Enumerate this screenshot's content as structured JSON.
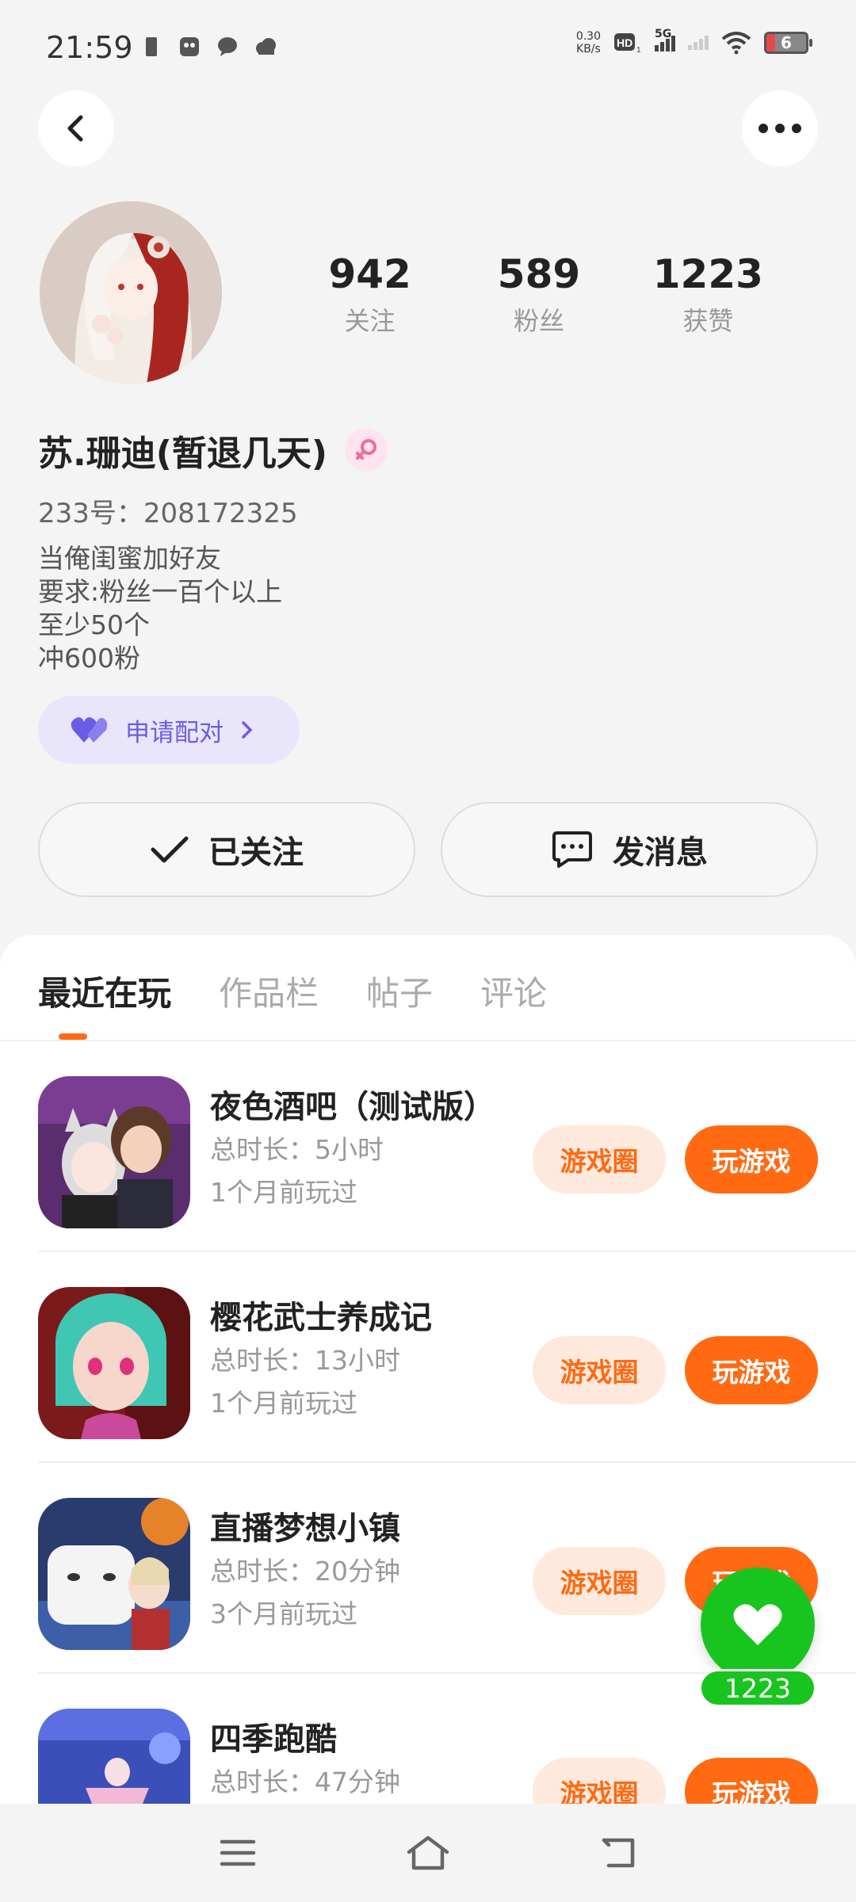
{
  "status_bar": {
    "time": "21:59",
    "net_speed_value": "0.30",
    "net_speed_unit": "KB/s",
    "network": "5G",
    "battery": "6"
  },
  "profile": {
    "username": "苏.珊迪(暂退几天)",
    "uid": "233号：208172325",
    "bio": [
      "当俺闺蜜加好友",
      "要求:粉丝一百个以上",
      "至少50个",
      "冲600粉"
    ],
    "stats": [
      {
        "value": "942",
        "label": "关注"
      },
      {
        "value": "589",
        "label": "粉丝"
      },
      {
        "value": "1223",
        "label": "获赞"
      }
    ],
    "pair_button": "申请配对",
    "follow_button": "已关注",
    "message_button": "发消息"
  },
  "tabs": [
    "最近在玩",
    "作品栏",
    "帖子",
    "评论"
  ],
  "games": [
    {
      "name": "夜色酒吧（测试版）",
      "duration": "总时长：5小时",
      "last_played": "1个月前玩过",
      "circle": "游戏圈",
      "play": "玩游戏"
    },
    {
      "name": "樱花武士养成记",
      "duration": "总时长：13小时",
      "last_played": "1个月前玩过",
      "circle": "游戏圈",
      "play": "玩游戏"
    },
    {
      "name": "直播梦想小镇",
      "duration": "总时长：20分钟",
      "last_played": "3个月前玩过",
      "circle": "游戏圈",
      "play": "玩游戏"
    },
    {
      "name": "四季跑酷",
      "duration": "总时长：47分钟",
      "last_played": "",
      "circle": "游戏圈",
      "play": "玩游戏"
    }
  ],
  "like": {
    "count": "1223"
  },
  "colors": {
    "accent": "#ff6a13",
    "like_green": "#18c51e",
    "pair_purple": "#6b5ce7"
  }
}
